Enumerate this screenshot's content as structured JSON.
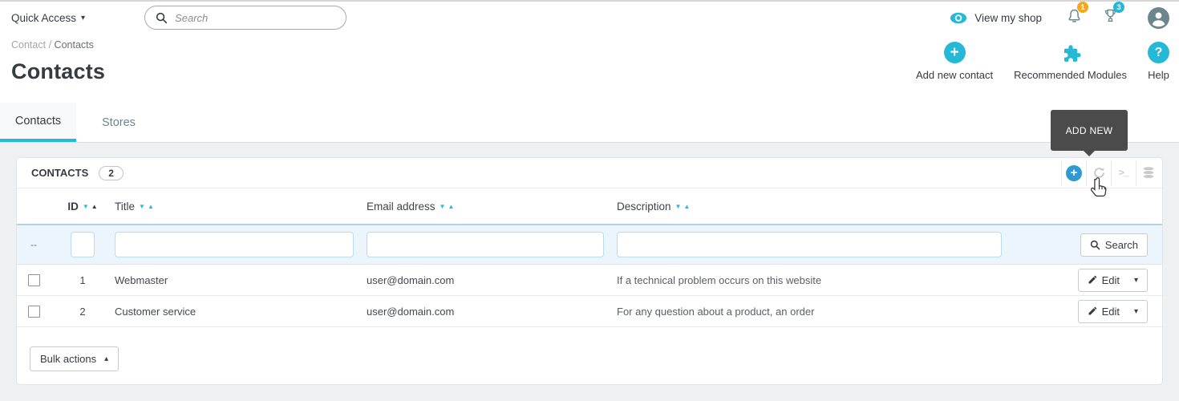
{
  "topbar": {
    "quick_access_label": "Quick Access",
    "search_placeholder": "Search",
    "view_my_shop_label": "View my shop",
    "notification_badge": "1",
    "achievement_badge": "3"
  },
  "breadcrumb": {
    "parent": "Contact",
    "separator": "/",
    "current": "Contacts"
  },
  "page": {
    "title": "Contacts"
  },
  "header_actions": [
    {
      "label": "Add new contact",
      "icon": "plus-circle-icon"
    },
    {
      "label": "Recommended Modules",
      "icon": "puzzle-icon"
    },
    {
      "label": "Help",
      "icon": "question-circle-icon"
    }
  ],
  "tabs": [
    {
      "label": "Contacts",
      "active": true
    },
    {
      "label": "Stores",
      "active": false
    }
  ],
  "tooltip": {
    "label": "ADD NEW"
  },
  "panel": {
    "title": "CONTACTS",
    "count": "2",
    "toolbar": [
      "add-new",
      "refresh-list",
      "show-sql-query",
      "export-to-sql-manager"
    ]
  },
  "table": {
    "columns": [
      "ID",
      "Title",
      "Email address",
      "Description"
    ],
    "sorted_column": "ID",
    "filter_dashes": "--",
    "search_button_label": "Search",
    "rows": [
      {
        "id": "1",
        "title": "Webmaster",
        "email": "user@domain.com",
        "description": "If a technical problem occurs on this website",
        "action": "Edit"
      },
      {
        "id": "2",
        "title": "Customer service",
        "email": "user@domain.com",
        "description": "For any question about a product, an order",
        "action": "Edit"
      }
    ]
  },
  "footer": {
    "bulk_actions_label": "Bulk actions"
  },
  "icons": {
    "sort_desc": "▼",
    "sort_asc": "▲",
    "caret_down_small": "▾",
    "caret_up_small": "▴",
    "plus_glyph": "+",
    "question_glyph": "?",
    "terminal_glyph": ">_"
  },
  "colors": {
    "primary": "#25b9d7",
    "toolbar_plus_blue": "#2e9ad0",
    "badge_orange": "#f7a818",
    "badge_cyan": "#25b9d7",
    "dark_text": "#363a41",
    "tooltip_bg": "#4b4b4b",
    "filter_row_bg": "#edf5fc",
    "content_bg": "#eef0f2"
  }
}
